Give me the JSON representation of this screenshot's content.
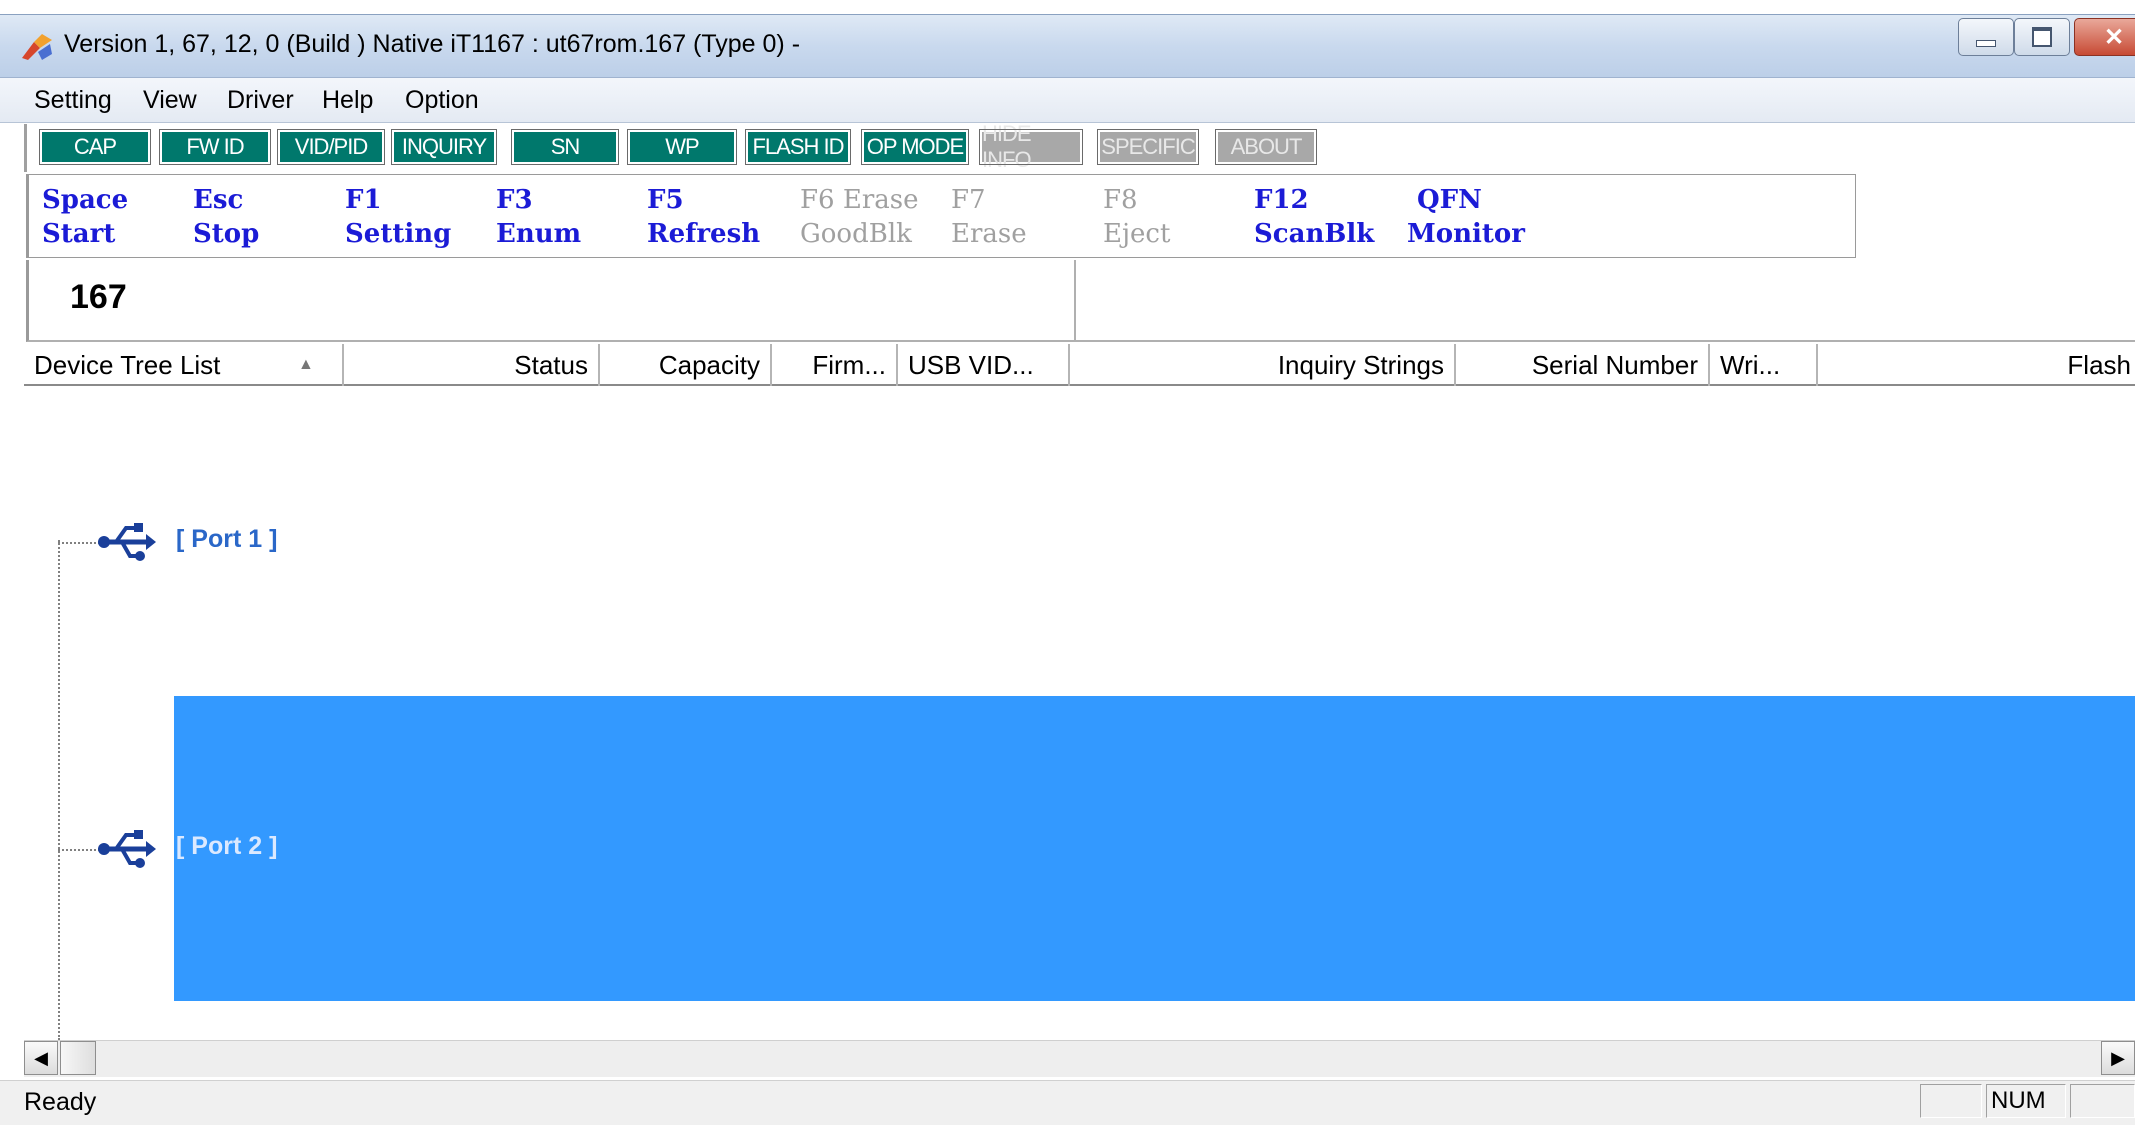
{
  "window": {
    "title": "Version 1, 67, 12, 0 (Build )  Native iT1167 : ut67rom.167  (Type 0)  -"
  },
  "menu": [
    "Setting",
    "View",
    "Driver",
    "Help",
    "Option"
  ],
  "info_buttons": [
    {
      "label": "CAP",
      "enabled": true
    },
    {
      "label": "FW ID",
      "enabled": true
    },
    {
      "label": "VID/PID",
      "enabled": true
    },
    {
      "label": "INQUIRY",
      "enabled": true
    },
    {
      "label": "SN",
      "enabled": true
    },
    {
      "label": "WP",
      "enabled": true
    },
    {
      "label": "FLASH ID",
      "enabled": true
    },
    {
      "label": "OP MODE",
      "enabled": true
    },
    {
      "label": "HIDE INFO",
      "enabled": false
    },
    {
      "label": "SPECIFIC",
      "enabled": false
    },
    {
      "label": "ABOUT",
      "enabled": false
    }
  ],
  "hotkeys": [
    {
      "key": "Space",
      "action": "Start",
      "enabled": true
    },
    {
      "key": "Esc",
      "action": "Stop",
      "enabled": true
    },
    {
      "key": "F1",
      "action": "Setting",
      "enabled": true
    },
    {
      "key": "F3",
      "action": "Enum",
      "enabled": true
    },
    {
      "key": "F5",
      "action": "Refresh",
      "enabled": true
    },
    {
      "key": "F6 Erase",
      "action": "GoodBlk",
      "enabled": false
    },
    {
      "key": "F7",
      "action": "Erase",
      "enabled": false
    },
    {
      "key": "F8",
      "action": "Eject",
      "enabled": false
    },
    {
      "key": "F12",
      "action": "ScanBlk",
      "enabled": true
    },
    {
      "key": "QFN",
      "action": "Monitor",
      "enabled": true
    }
  ],
  "counter": "167",
  "columns": {
    "device_tree": "Device Tree List",
    "sort_arrow": "▲",
    "status": "Status",
    "capacity": "Capacity",
    "firmware": "Firm...",
    "usb_vid": "USB VID...",
    "inquiry": "Inquiry Strings",
    "serial": "Serial Number",
    "write": "Wri...",
    "flash": "Flash"
  },
  "ports": [
    {
      "label": "[ Port  1 ]",
      "selected": false
    },
    {
      "label": "[ Port  2 ]",
      "selected": true
    }
  ],
  "statusbar": {
    "text": "Ready",
    "num": "NUM"
  },
  "colors": {
    "accent_button": "#00786c",
    "disabled_button": "#a8a8a8",
    "hotkey_text": "#1b1bd6",
    "selection": "#3399ff",
    "port_text": "#2a67c8"
  }
}
